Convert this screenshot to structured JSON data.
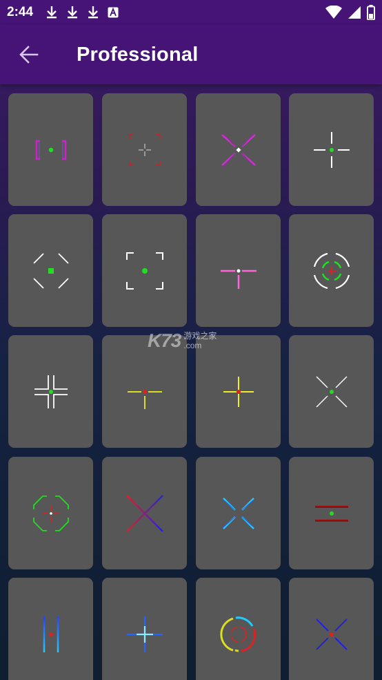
{
  "status_bar": {
    "time": "2:44",
    "icons": [
      "download-icon",
      "download-icon",
      "download-icon",
      "font-a-icon",
      "wifi-icon",
      "signal-icon",
      "battery-icon"
    ]
  },
  "app_bar": {
    "title": "Professional",
    "back_icon": "arrow-left-icon"
  },
  "watermark": {
    "logo": "K73",
    "cn": "游戏之家",
    "domain": ".com"
  },
  "crosshairs": [
    {
      "id": "brackets-green-dot",
      "colors": [
        "#cc22cc",
        "#22dd22"
      ]
    },
    {
      "id": "red-corners-white-cross",
      "colors": [
        "#cc2222",
        "#ffffff"
      ]
    },
    {
      "id": "magenta-x-white-dot",
      "colors": [
        "#cc33cc",
        "#ffffff"
      ]
    },
    {
      "id": "white-cross-green-dot",
      "colors": [
        "#ffffff",
        "#22dd22"
      ]
    },
    {
      "id": "white-diagonals-green-square",
      "colors": [
        "#ffffff",
        "#22dd22"
      ]
    },
    {
      "id": "white-corners-green-dot",
      "colors": [
        "#ffffff",
        "#22dd22"
      ]
    },
    {
      "id": "pink-t-white-dot",
      "colors": [
        "#ff66dd",
        "#ffffff"
      ]
    },
    {
      "id": "white-circle-green-arcs-red-cross",
      "colors": [
        "#ffffff",
        "#22dd22",
        "#dd2222"
      ]
    },
    {
      "id": "white-corner-cross-green-dot",
      "colors": [
        "#ffffff",
        "#22dd22"
      ]
    },
    {
      "id": "yellow-t-red-dot",
      "colors": [
        "#dddd22",
        "#dd2222"
      ]
    },
    {
      "id": "yellow-cross-red-dot",
      "colors": [
        "#eeee22",
        "#dd2222"
      ]
    },
    {
      "id": "white-x-green-dot",
      "colors": [
        "#ffffff",
        "#22dd22"
      ]
    },
    {
      "id": "green-octagon-red-cross",
      "colors": [
        "#22dd22",
        "#dd2222",
        "#ffffff"
      ]
    },
    {
      "id": "red-blue-x",
      "colors": [
        "#dd2222",
        "#2222dd"
      ]
    },
    {
      "id": "cyan-x",
      "colors": [
        "#22ccff",
        "#2266ff"
      ]
    },
    {
      "id": "red-bars-green-dot",
      "colors": [
        "#aa1111",
        "#22dd22"
      ]
    },
    {
      "id": "blue-vertical-bars-red-dot",
      "colors": [
        "#2266ff",
        "#22ccff",
        "#dd2222"
      ]
    },
    {
      "id": "blue-cyan-cross",
      "colors": [
        "#2266ff",
        "#66ddff"
      ]
    },
    {
      "id": "rainbow-circle",
      "colors": [
        "#dddd22",
        "#22ccff",
        "#dd2222"
      ]
    },
    {
      "id": "blue-x-red-dot",
      "colors": [
        "#2222dd",
        "#dd2222"
      ]
    }
  ]
}
